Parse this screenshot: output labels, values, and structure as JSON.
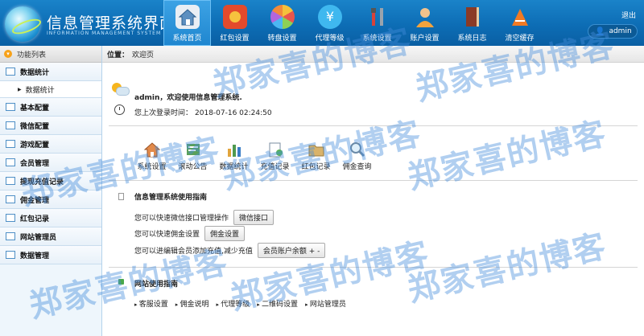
{
  "header": {
    "brand_title": "信息管理系统界面",
    "brand_sub": "INFORMATION MANAGEMENT SYSTEM GUI",
    "logout": "退出",
    "user": "admin",
    "nav": [
      {
        "label": "系统首页",
        "icon": "home-icon",
        "color": "#e9eef4"
      },
      {
        "label": "红包设置",
        "icon": "red-packet-icon",
        "color": "#e34a2c"
      },
      {
        "label": "转盘设置",
        "icon": "wheel-icon",
        "color": "#f3c03b"
      },
      {
        "label": "代理等级",
        "icon": "yen-icon",
        "color": "#3fb8ef"
      },
      {
        "label": "系统设置",
        "icon": "tools-icon",
        "color": "#d7423a"
      },
      {
        "label": "账户设置",
        "icon": "user-icon",
        "color": "#f2a33d"
      },
      {
        "label": "系统日志",
        "icon": "book-icon",
        "color": "#8a3a26"
      },
      {
        "label": "清空缓存",
        "icon": "clear-cache-icon",
        "color": "#f17a23"
      }
    ]
  },
  "sidebar": {
    "title": "功能列表",
    "items": [
      {
        "label": "数据统计"
      },
      {
        "label": "基本配置"
      },
      {
        "label": "微信配置"
      },
      {
        "label": "游戏配置"
      },
      {
        "label": "会员管理"
      },
      {
        "label": "提现充值记录"
      },
      {
        "label": "佣金管理"
      },
      {
        "label": "红包记录"
      },
      {
        "label": "网站管理员"
      },
      {
        "label": "数据管理"
      }
    ],
    "sub_item": "数据统计"
  },
  "main": {
    "crumb_label": "位置：",
    "crumb_value": "欢迎页",
    "welcome_user": "admin",
    "welcome_text": "，欢迎使用信息管理系统.",
    "last_login_label": "您上次登录时间：",
    "last_login_time": "2018-07-16 02:24:50",
    "quick_links": [
      {
        "label": "系统设置",
        "icon": "house-icon"
      },
      {
        "label": "滚动公告",
        "icon": "announcement-icon"
      },
      {
        "label": "数据统计",
        "icon": "stats-icon"
      },
      {
        "label": "充值记录",
        "icon": "recharge-icon"
      },
      {
        "label": "红包记录",
        "icon": "folder-icon"
      },
      {
        "label": "佣金查询",
        "icon": "search-icon"
      }
    ],
    "guide_title": "信息管理系统使用指南",
    "guide_rows": [
      {
        "text": "您可以快速微信接口管理操作",
        "button": "微信接口"
      },
      {
        "text": "您可以快速佣金设置",
        "button": "佣金设置"
      },
      {
        "text": "您可以进编辑会员添加充值,减少充值",
        "button": "会员账户余额 + -"
      }
    ],
    "site_title": "网站使用指南",
    "site_links": [
      "客服设置",
      "佣金说明",
      "代理等级",
      "二维码设置",
      "网站管理员"
    ]
  },
  "watermark": "郑家喜的博客"
}
